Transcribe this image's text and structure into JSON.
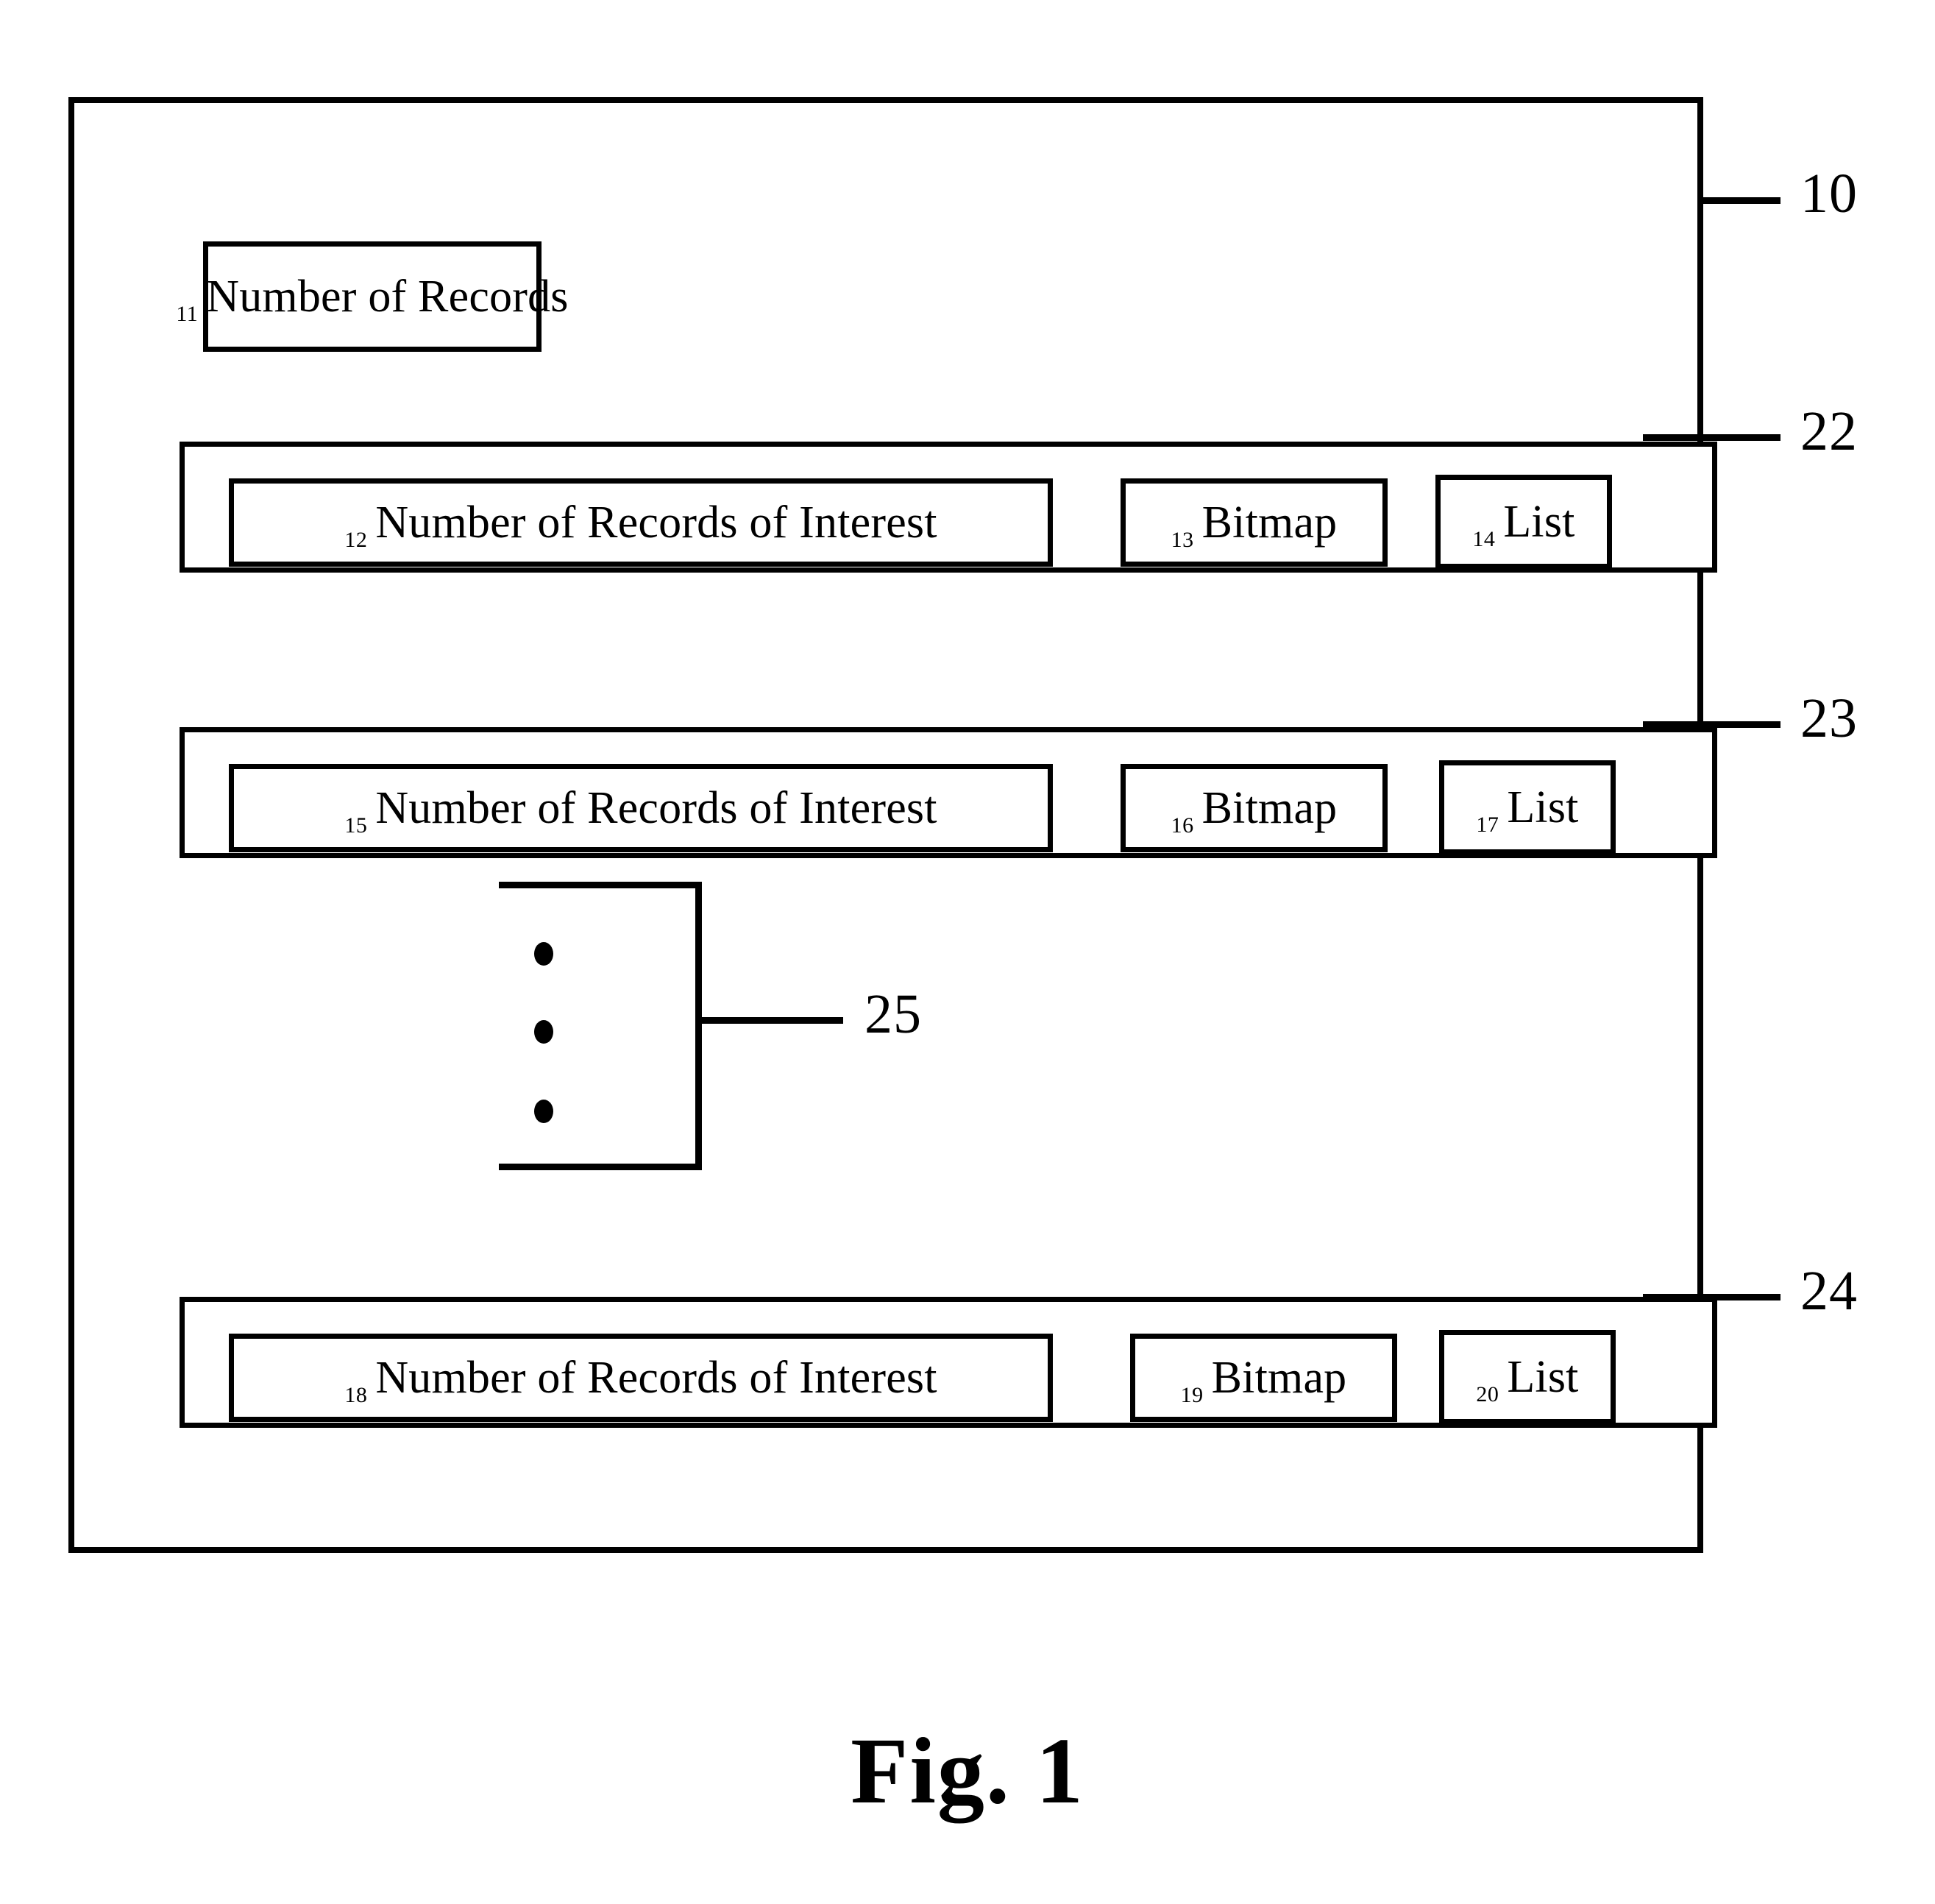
{
  "figure": {
    "caption": "Fig. 1",
    "outer_structure": {
      "ref": "10",
      "record_count_field": {
        "ref": "11",
        "label": "Number of Records"
      },
      "groups": [
        {
          "ref": "22",
          "fields": [
            {
              "ref": "12",
              "label": "Number of Records of Interest"
            },
            {
              "ref": "13",
              "label": "Bitmap"
            },
            {
              "ref": "14",
              "label": "List"
            }
          ]
        },
        {
          "ref": "23",
          "fields": [
            {
              "ref": "15",
              "label": "Number of Records of Interest"
            },
            {
              "ref": "16",
              "label": "Bitmap"
            },
            {
              "ref": "17",
              "label": "List"
            }
          ]
        },
        {
          "ref": "24",
          "fields": [
            {
              "ref": "18",
              "label": "Number of Records of Interest"
            },
            {
              "ref": "19",
              "label": "Bitmap"
            },
            {
              "ref": "20",
              "label": "List"
            }
          ]
        }
      ],
      "ellipsis_group": {
        "ref": "25",
        "dots": 3
      }
    },
    "colors": {
      "stroke": "#000000",
      "background": "#ffffff"
    }
  }
}
